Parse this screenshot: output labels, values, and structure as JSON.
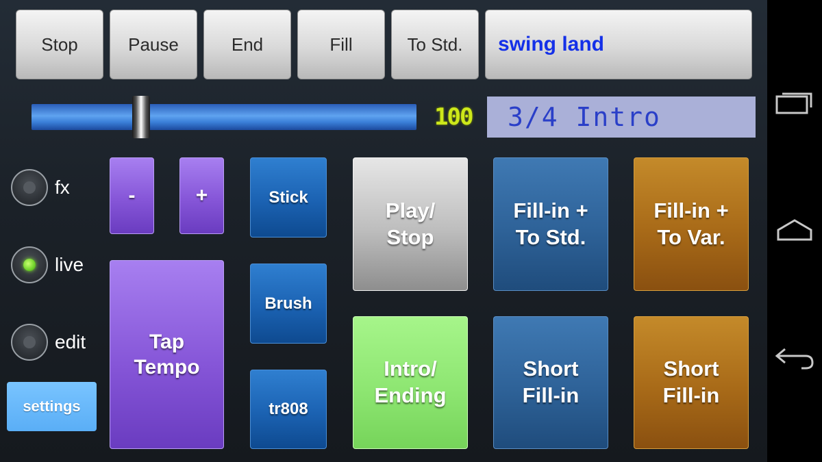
{
  "top_buttons": {
    "stop": "Stop",
    "pause": "Pause",
    "end": "End",
    "fill": "Fill",
    "to_std": "To Std."
  },
  "style_name": "swing land",
  "tempo": {
    "value": "100"
  },
  "status_display": "3/4  Intro",
  "modes": {
    "fx": {
      "label": "fx",
      "selected": false
    },
    "live": {
      "label": "live",
      "selected": true
    },
    "edit": {
      "label": "edit",
      "selected": false
    }
  },
  "settings_label": "settings",
  "tempo_controls": {
    "minus": "-",
    "plus": "+",
    "tap": "Tap\nTempo"
  },
  "kits": {
    "stick": "Stick",
    "brush": "Brush",
    "tr808": "tr808"
  },
  "pads": {
    "play_stop": "Play/\nStop",
    "intro_ending": "Intro/\nEnding",
    "fill_to_std": "Fill-in +\nTo Std.",
    "fill_to_var": "Fill-in +\nTo Var.",
    "short_fill_1": "Short\nFill-in",
    "short_fill_2": "Short\nFill-in"
  },
  "colors": {
    "style_name": "#1430e8",
    "tempo_readout": "#cde81a",
    "status_bg": "#aab0d8",
    "status_text": "#2a3fc8",
    "live_indicator": "#6fd12a"
  },
  "nav_icons": [
    "recent-apps-icon",
    "home-icon",
    "back-icon"
  ]
}
